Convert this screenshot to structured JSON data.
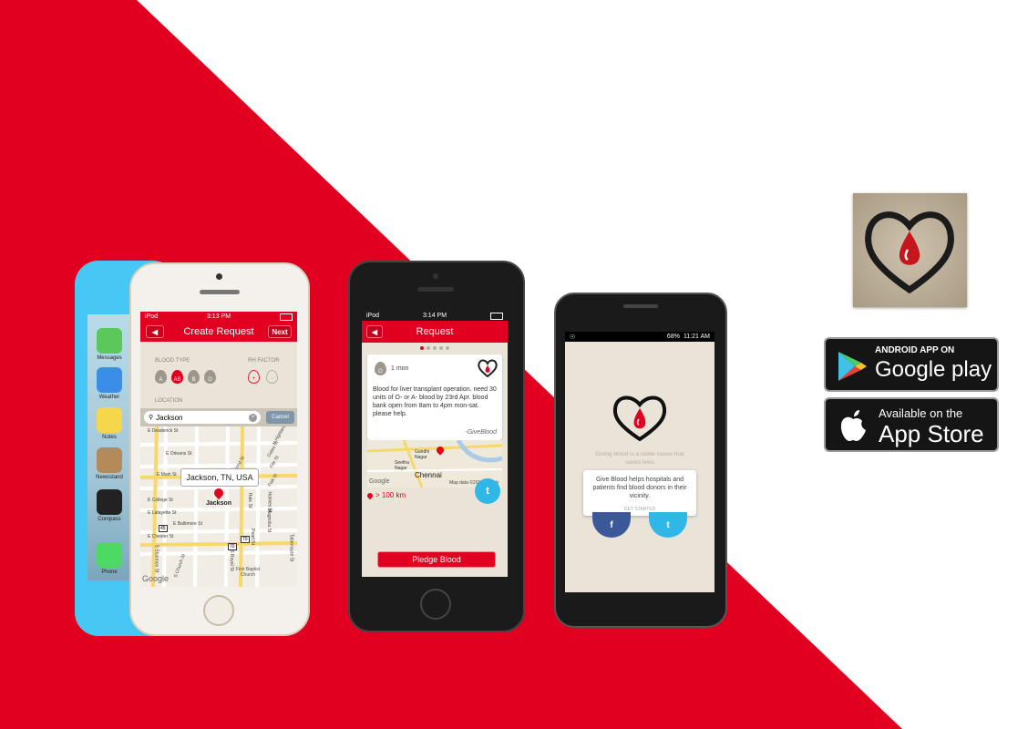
{
  "colors": {
    "brand_red": "#e1001f",
    "paper": "#e9e3d8",
    "dark": "#151515"
  },
  "iphone5c": {
    "apps": [
      {
        "label": "Messages",
        "icon": "messages-icon",
        "color": "#5ac85a"
      },
      {
        "label": "Weather",
        "icon": "weather-icon",
        "color": "#3a8ee6"
      },
      {
        "label": "Notes",
        "icon": "notes-icon",
        "color": "#f6d64a"
      },
      {
        "label": "Newsstand",
        "icon": "newsstand-icon",
        "color": "#b48a5a"
      },
      {
        "label": "Compass",
        "icon": "compass-icon",
        "color": "#222222"
      },
      {
        "label": "Phone",
        "icon": "phone-icon",
        "color": "#4cd964"
      }
    ]
  },
  "create_request": {
    "status": {
      "carrier": "iPod",
      "time": "3:13 PM"
    },
    "title": "Create Request",
    "next_label": "Next",
    "blood_type_label": "BLOOD TYPE",
    "blood_types": [
      "A",
      "AB",
      "B",
      "O"
    ],
    "selected_blood_type": "AB",
    "rh_factor_label": "RH FACTOR",
    "rh": [
      "+",
      "−"
    ],
    "location_label": "LOCATION",
    "search_value": "Jackson",
    "cancel_label": "Cancel",
    "map": {
      "callout": "Jackson, TN, USA",
      "pin_label": "Jackson",
      "streets": [
        "E Deaderick St",
        "E Orleans St",
        "E Main St",
        "E College St",
        "E Lafayette St",
        "E Baltimore St",
        "E Chester St",
        "S Shannon St",
        "S Royal St",
        "N Highland Ave",
        "Gates St",
        "Fite St",
        "Fisk St",
        "Hale St",
        "Holmes St",
        "Pearl St",
        "Magnolia St",
        "Tabernacle St",
        "Bond St",
        "S Church St"
      ],
      "road_badges": [
        "70",
        "45",
        "70"
      ],
      "poi": [
        "First Baptist Church"
      ],
      "attribution": "Google"
    }
  },
  "request": {
    "status": {
      "carrier": "iPod",
      "time": "3:14 PM"
    },
    "title": "Request",
    "age": "1 mon",
    "drop_label": "O",
    "message": "Blood for liver transplant operation. need 30 units of O- or A- blood by 23rd Apr. blood bank open from 8am to 4pm mon-sat. please help.",
    "signature": "-GiveBlood",
    "map": {
      "labels": [
        "Gandhi Nagar",
        "Seetha Nagar",
        "Chennai"
      ],
      "attribution": "Map data ©2013 Google",
      "google": "Google"
    },
    "distance": "> 100 km",
    "pledge_label": "Pledge Blood",
    "pager_dots": 5,
    "pager_active": 0
  },
  "android": {
    "status": {
      "time": "11:21 AM",
      "battery": "68%"
    },
    "tagline": "Giving blood is a noble cause that saves lives",
    "card_text": "Give Blood helps hospitals and patients find blood donors in their vicinity.",
    "get_started": "GET STARTED"
  },
  "stores": {
    "google": {
      "small": "ANDROID APP ON",
      "big": "Google play"
    },
    "apple": {
      "small": "Available on the",
      "big": "App Store"
    }
  }
}
